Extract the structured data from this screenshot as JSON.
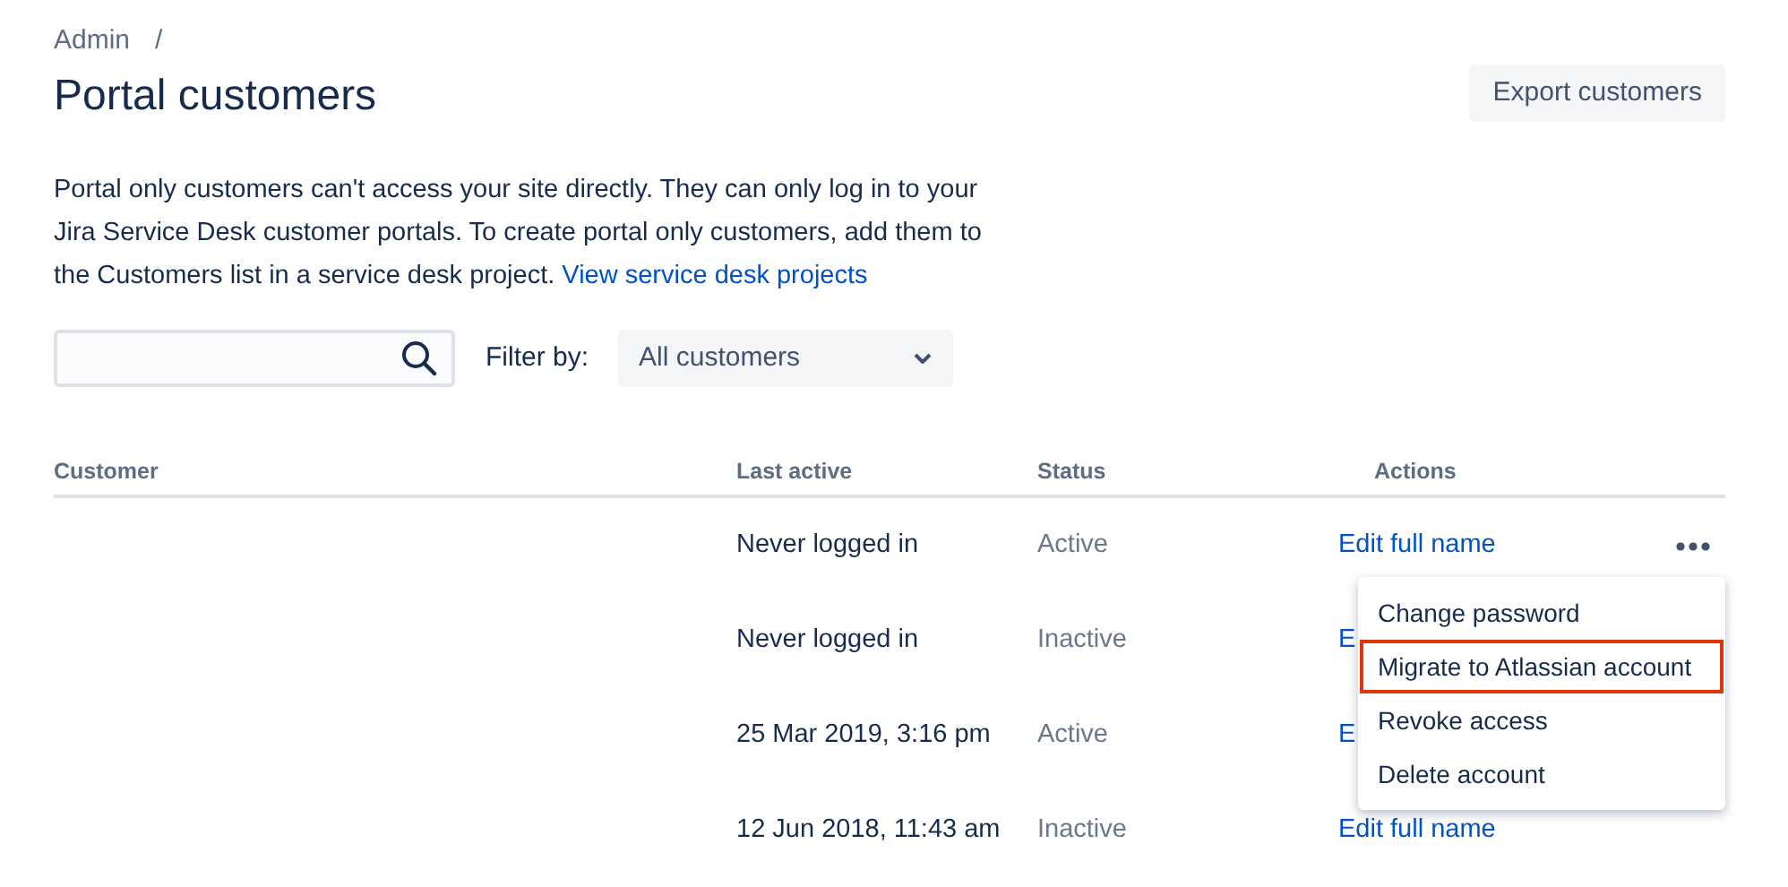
{
  "breadcrumb": {
    "items": [
      "Admin"
    ],
    "separator": "/"
  },
  "title": "Portal customers",
  "export_button": "Export customers",
  "description": {
    "text": "Portal only customers can't access your site directly. They can only log in to your Jira Service Desk customer portals. To create portal only customers, add them to the Customers list in a service desk project.",
    "link": "View service desk projects"
  },
  "filter": {
    "label": "Filter by:",
    "value": "All customers"
  },
  "table": {
    "columns": [
      "Customer",
      "Last active",
      "Status",
      "Actions"
    ],
    "rows": [
      {
        "last_active": "Never logged in",
        "status": "Active",
        "action": "Edit full name",
        "more": true
      },
      {
        "last_active": "Never logged in",
        "status": "Inactive",
        "action": "E"
      },
      {
        "last_active": "25 Mar 2019, 3:16 pm",
        "status": "Active",
        "action": "E"
      },
      {
        "last_active": "12 Jun 2018, 11:43 am",
        "status": "Inactive",
        "action": "Edit full name"
      }
    ]
  },
  "menu": {
    "items": [
      {
        "label": "Change password",
        "highlighted": false
      },
      {
        "label": "Migrate to Atlassian account",
        "highlighted": true
      },
      {
        "label": "Revoke access",
        "highlighted": false
      },
      {
        "label": "Delete account",
        "highlighted": false
      }
    ]
  }
}
